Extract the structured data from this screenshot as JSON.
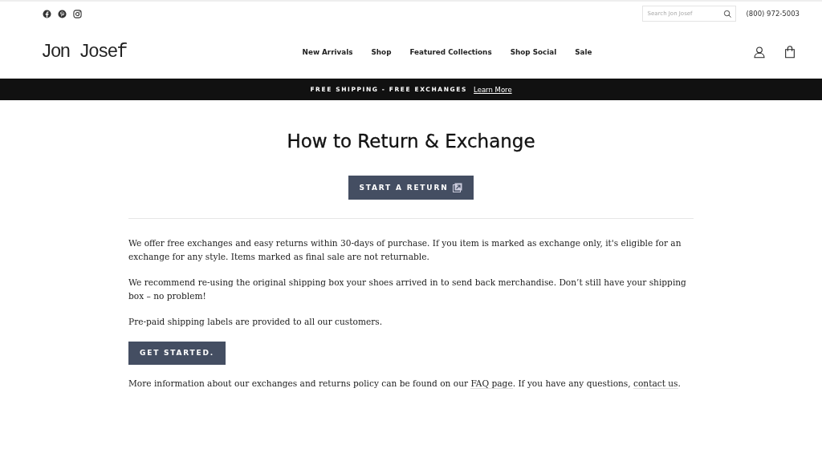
{
  "topbar": {
    "search": {
      "placeholder": "Search Jon Josef"
    },
    "phone": "(800) 972-5003"
  },
  "header": {
    "logo": "Jon Josef",
    "nav": [
      "New Arrivals",
      "Shop",
      "Featured Collections",
      "Shop Social",
      "Sale"
    ]
  },
  "announcement": {
    "text": "FREE SHIPPING - FREE EXCHANGES",
    "link": "Learn More"
  },
  "page": {
    "title": "How to Return & Exchange",
    "start_button": "START A RETURN",
    "paragraphs": [
      "We offer free exchanges and easy returns within 30-days of purchase. If you item is marked as exchange only, it's eligible for an exchange for any style. Items marked as final sale are not returnable.",
      "We recommend re-using the original shipping box your shoes arrived in to send back merchandise. Don’t still have your shipping box – no problem!",
      "Pre-paid shipping labels are provided to all our customers."
    ],
    "get_started_button": "GET STARTED.",
    "info": [
      {
        "kind": "text",
        "text": "More information about our exchanges and returns policy can be found on our "
      },
      {
        "kind": "link",
        "text": "FAQ page"
      },
      {
        "kind": "text",
        "text": ". If you have any questions, "
      },
      {
        "kind": "link",
        "text": "contact us"
      },
      {
        "kind": "text",
        "text": "."
      }
    ]
  }
}
